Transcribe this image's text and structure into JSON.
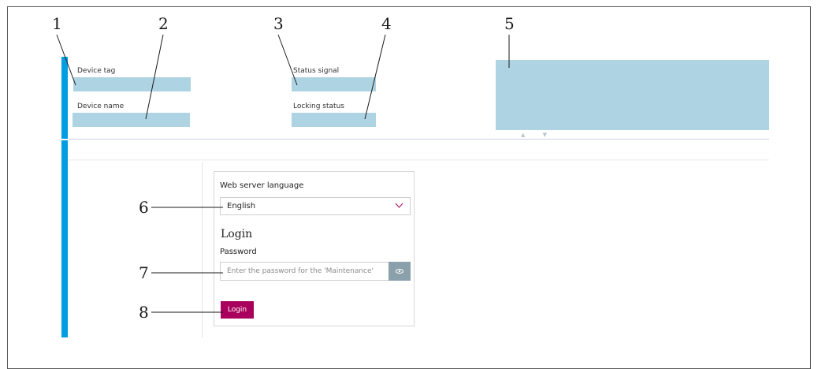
{
  "callouts": [
    "1",
    "2",
    "3",
    "4",
    "5",
    "6",
    "7",
    "8"
  ],
  "header": {
    "device_tag_label": "Device tag",
    "device_name_label": "Device name",
    "status_signal_label": "Status signal",
    "locking_status_label": "Locking status",
    "navigation_arrows": "▲ ▼"
  },
  "login_panel": {
    "language_label": "Web server language",
    "language_value": "English",
    "login_title": "Login",
    "password_label": "Password",
    "password_placeholder": "Enter the password for the 'Maintenance'",
    "login_button": "Login"
  },
  "colors": {
    "accent_blue": "#009de0",
    "field_fill": "#aed3e3",
    "login_button": "#a8005c",
    "eye_button": "#8aa0ab"
  },
  "icons": {
    "dropdown": "chevron-down-icon",
    "show_password": "eye-icon"
  }
}
